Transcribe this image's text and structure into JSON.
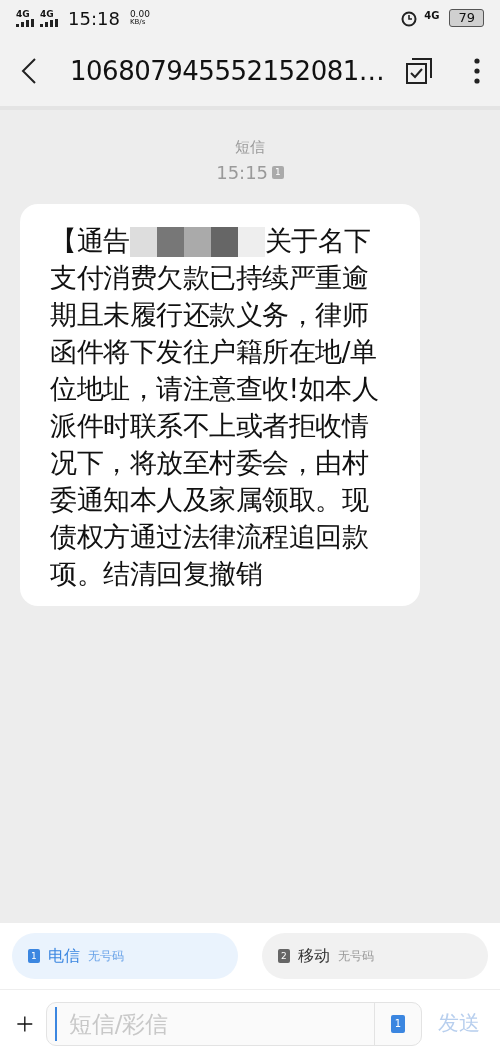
{
  "status_bar": {
    "signals": [
      "4G",
      "4G"
    ],
    "time": "15:18",
    "speed_value": "0.00",
    "speed_unit": "KB/s",
    "network": "4G",
    "battery": "79"
  },
  "header": {
    "title": "106807945552152081…"
  },
  "meta": {
    "label": "短信",
    "time": "15:15",
    "sim": "1"
  },
  "message": {
    "before": "【通告",
    "redacted": true,
    "after": "关于名下支付消费欠款已持续严重逾期且未履行还款义务，律师函件将下发往户籍所在地/单位地址，请注意查收!如本人派件时联系不上或者拒收情况下，将放至村委会，由村委通知本人及家属领取。现债权方通过法律流程追回款项。结清回复撤销"
  },
  "sim_tabs": [
    {
      "badge": "1",
      "carrier": "电信",
      "number": "无号码",
      "selected": true
    },
    {
      "badge": "2",
      "carrier": "移动",
      "number": "无号码",
      "selected": false
    }
  ],
  "composer": {
    "placeholder": "短信/彩信",
    "sim": "1",
    "send": "发送",
    "send_disabled": true
  }
}
